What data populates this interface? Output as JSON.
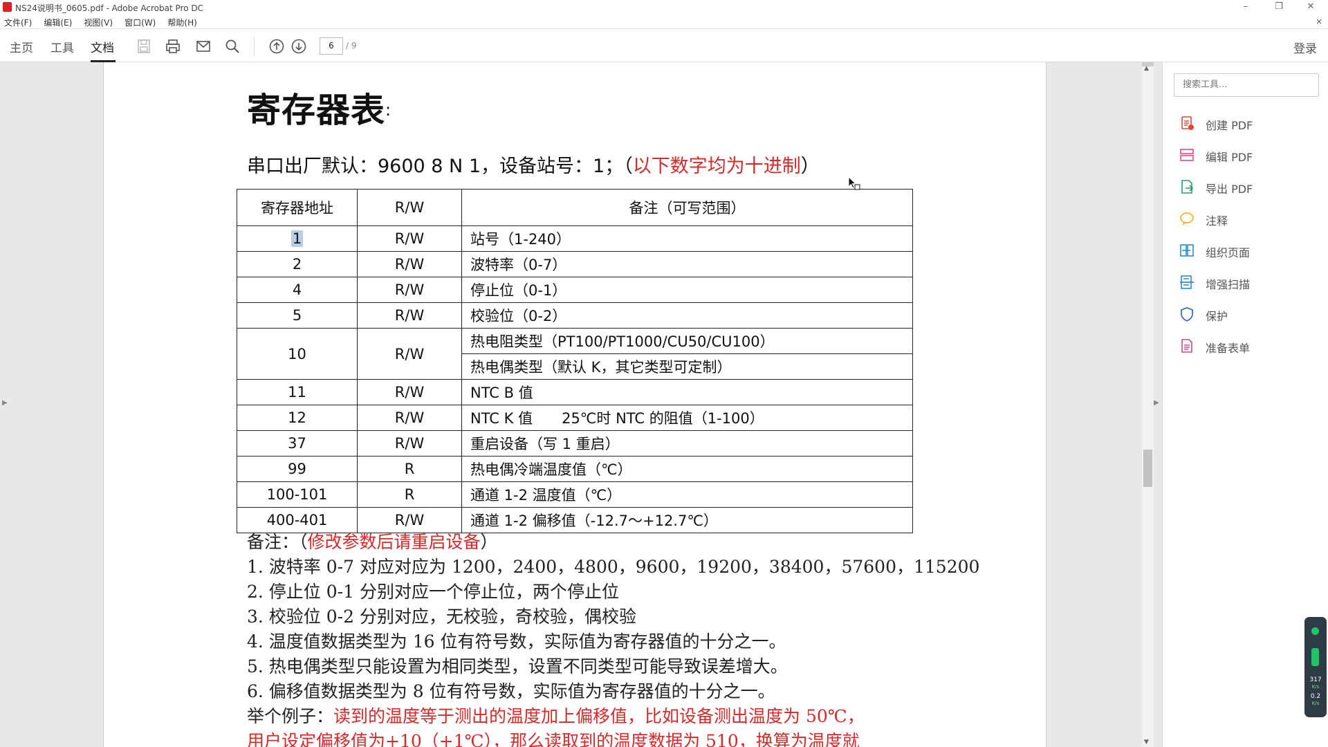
{
  "window": {
    "title": "NS24说明书_0605.pdf - Adobe Acrobat Pro DC",
    "minimize": "–",
    "restore": "❐",
    "close": "✕"
  },
  "menu": [
    "文件(F)",
    "编辑(E)",
    "视图(V)",
    "窗口(W)",
    "帮助(H)"
  ],
  "menu_close": "×",
  "toolbar": {
    "tabs": [
      "主页",
      "工具",
      "文档"
    ],
    "active_tab": "文档",
    "page_current": "6",
    "page_total": "/ 9",
    "login": "登录"
  },
  "document": {
    "heading": "寄存器表",
    "heading_colon": ":",
    "serial_default": "串口出厂默认：9600 8 N 1，设备站号：1；（",
    "decimal_note": "以下数字均为十进制",
    "closing_paren": "）",
    "table": {
      "headers": [
        "寄存器地址",
        "R/W",
        "备注（可写范围）"
      ],
      "rows": [
        {
          "addr": "1",
          "rw": "R/W",
          "note": "站号（1-240）"
        },
        {
          "addr": "2",
          "rw": "R/W",
          "note": "波特率（0-7）"
        },
        {
          "addr": "4",
          "rw": "R/W",
          "note": "停止位（0-1）"
        },
        {
          "addr": "5",
          "rw": "R/W",
          "note": "校验位（0-2）"
        },
        {
          "addr": "10",
          "rw": "R/W",
          "note": "热电阻类型（PT100/PT1000/CU50/CU100）",
          "note2": "热电偶类型（默认 K，其它类型可定制）"
        },
        {
          "addr": "11",
          "rw": "R/W",
          "note": "NTC B 值"
        },
        {
          "addr": "12",
          "rw": "R/W",
          "note": "NTC K 值　　25℃时 NTC 的阻值（1-100）"
        },
        {
          "addr": "37",
          "rw": "R/W",
          "note": "重启设备（写 1 重启）"
        },
        {
          "addr": "99",
          "rw": "R",
          "note": "热电偶冷端温度值（℃）"
        },
        {
          "addr": "100-101",
          "rw": "R",
          "note": "通道 1-2 温度值（℃）"
        },
        {
          "addr": "400-401",
          "rw": "R/W",
          "note": "通道 1-2 偏移值（-12.7～+12.7℃）"
        }
      ]
    },
    "remarks_label": "备注：（",
    "remarks_red": "修改参数后请重启设备",
    "remarks_close": "）",
    "notes": [
      "1. 波特率 0-7 对应对应为 1200，2400，4800，9600，19200，38400，57600，115200",
      "2. 停止位 0-1 分别对应一个停止位，两个停止位",
      "3. 校验位 0-2 分别对应，无校验，奇校验，偶校验",
      "4. 温度值数据类型为 16 位有符号数，实际值为寄存器值的十分之一。",
      "5. 热电偶类型只能设置为相同类型，设置不同类型可能导致误差增大。",
      "6. 偏移值数据类型为 8 位有符号数，实际值为寄存器值的十分之一。"
    ],
    "example_label": "举个例子：",
    "example_red": "读到的温度等于测出的温度加上偏移值，比如设备测出温度为 50℃，",
    "example_red2": "用户设定偏移值为+10（+1℃），那么读取到的温度数据为 510，换算为温度就"
  },
  "tools_panel": {
    "search_placeholder": "搜索工具...",
    "items": [
      {
        "label": "创建 PDF",
        "icon": "create-pdf-icon",
        "color": "#e0463a"
      },
      {
        "label": "编辑 PDF",
        "icon": "edit-pdf-icon",
        "color": "#d94f8c"
      },
      {
        "label": "导出 PDF",
        "icon": "export-pdf-icon",
        "color": "#2a9d6f"
      },
      {
        "label": "注释",
        "icon": "comment-icon",
        "color": "#f2b632"
      },
      {
        "label": "组织页面",
        "icon": "organize-pages-icon",
        "color": "#2a8fc9"
      },
      {
        "label": "增强扫描",
        "icon": "enhance-scan-icon",
        "color": "#2a8fc9"
      },
      {
        "label": "保护",
        "icon": "protect-icon",
        "color": "#3a6fc9"
      },
      {
        "label": "准备表单",
        "icon": "prepare-form-icon",
        "color": "#c64b8c"
      }
    ]
  },
  "net_widget": {
    "down_value": "317",
    "down_unit": "K/s",
    "up_value": "0.2",
    "up_unit": "K/s"
  }
}
